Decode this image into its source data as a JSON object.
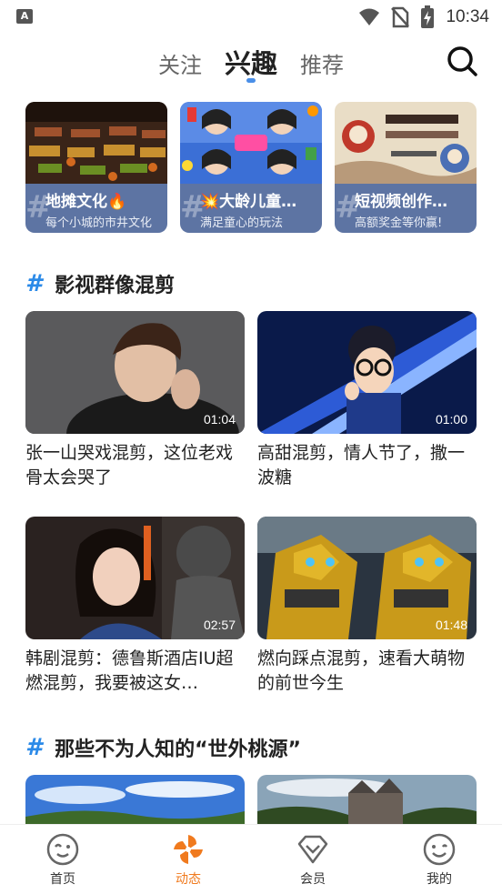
{
  "status_bar": {
    "time": "10:34",
    "app_icon_letter": "A"
  },
  "top_tabs": [
    {
      "label": "关注"
    },
    {
      "label": "兴趣"
    },
    {
      "label": "推荐"
    }
  ],
  "topics": [
    {
      "title": "地摊文化🔥",
      "subtitle": "每个小城的市井文化"
    },
    {
      "title": "💥大龄儿童…",
      "subtitle": "满足童心的玩法"
    },
    {
      "title": "短视频创作…",
      "subtitle": "高额奖金等你赢!"
    }
  ],
  "sections": [
    {
      "hash": "#",
      "title": "影视群像混剪",
      "videos": [
        {
          "duration": "01:04",
          "title": "张一山哭戏混剪，这位老戏骨太会哭了"
        },
        {
          "duration": "01:00",
          "title": "高甜混剪，情人节了，撒一波糖"
        },
        {
          "duration": "02:57",
          "title": "韩剧混剪：德鲁斯酒店IU超燃混剪，我要被这女…"
        },
        {
          "duration": "01:48",
          "title": "燃向踩点混剪，速看大萌物的前世今生"
        }
      ]
    },
    {
      "hash": "#",
      "title": "那些不为人知的“世外桃源”"
    }
  ],
  "bottom_nav": [
    {
      "label": "首页",
      "icon": "home-face-icon"
    },
    {
      "label": "动态",
      "icon": "pinwheel-icon"
    },
    {
      "label": "会员",
      "icon": "diamond-icon"
    },
    {
      "label": "我的",
      "icon": "smile-face-icon"
    }
  ],
  "colors": {
    "accent": "#2b8ae8",
    "active_nav": "#f07a1e",
    "topic_info_bg": "#5d74a3"
  }
}
